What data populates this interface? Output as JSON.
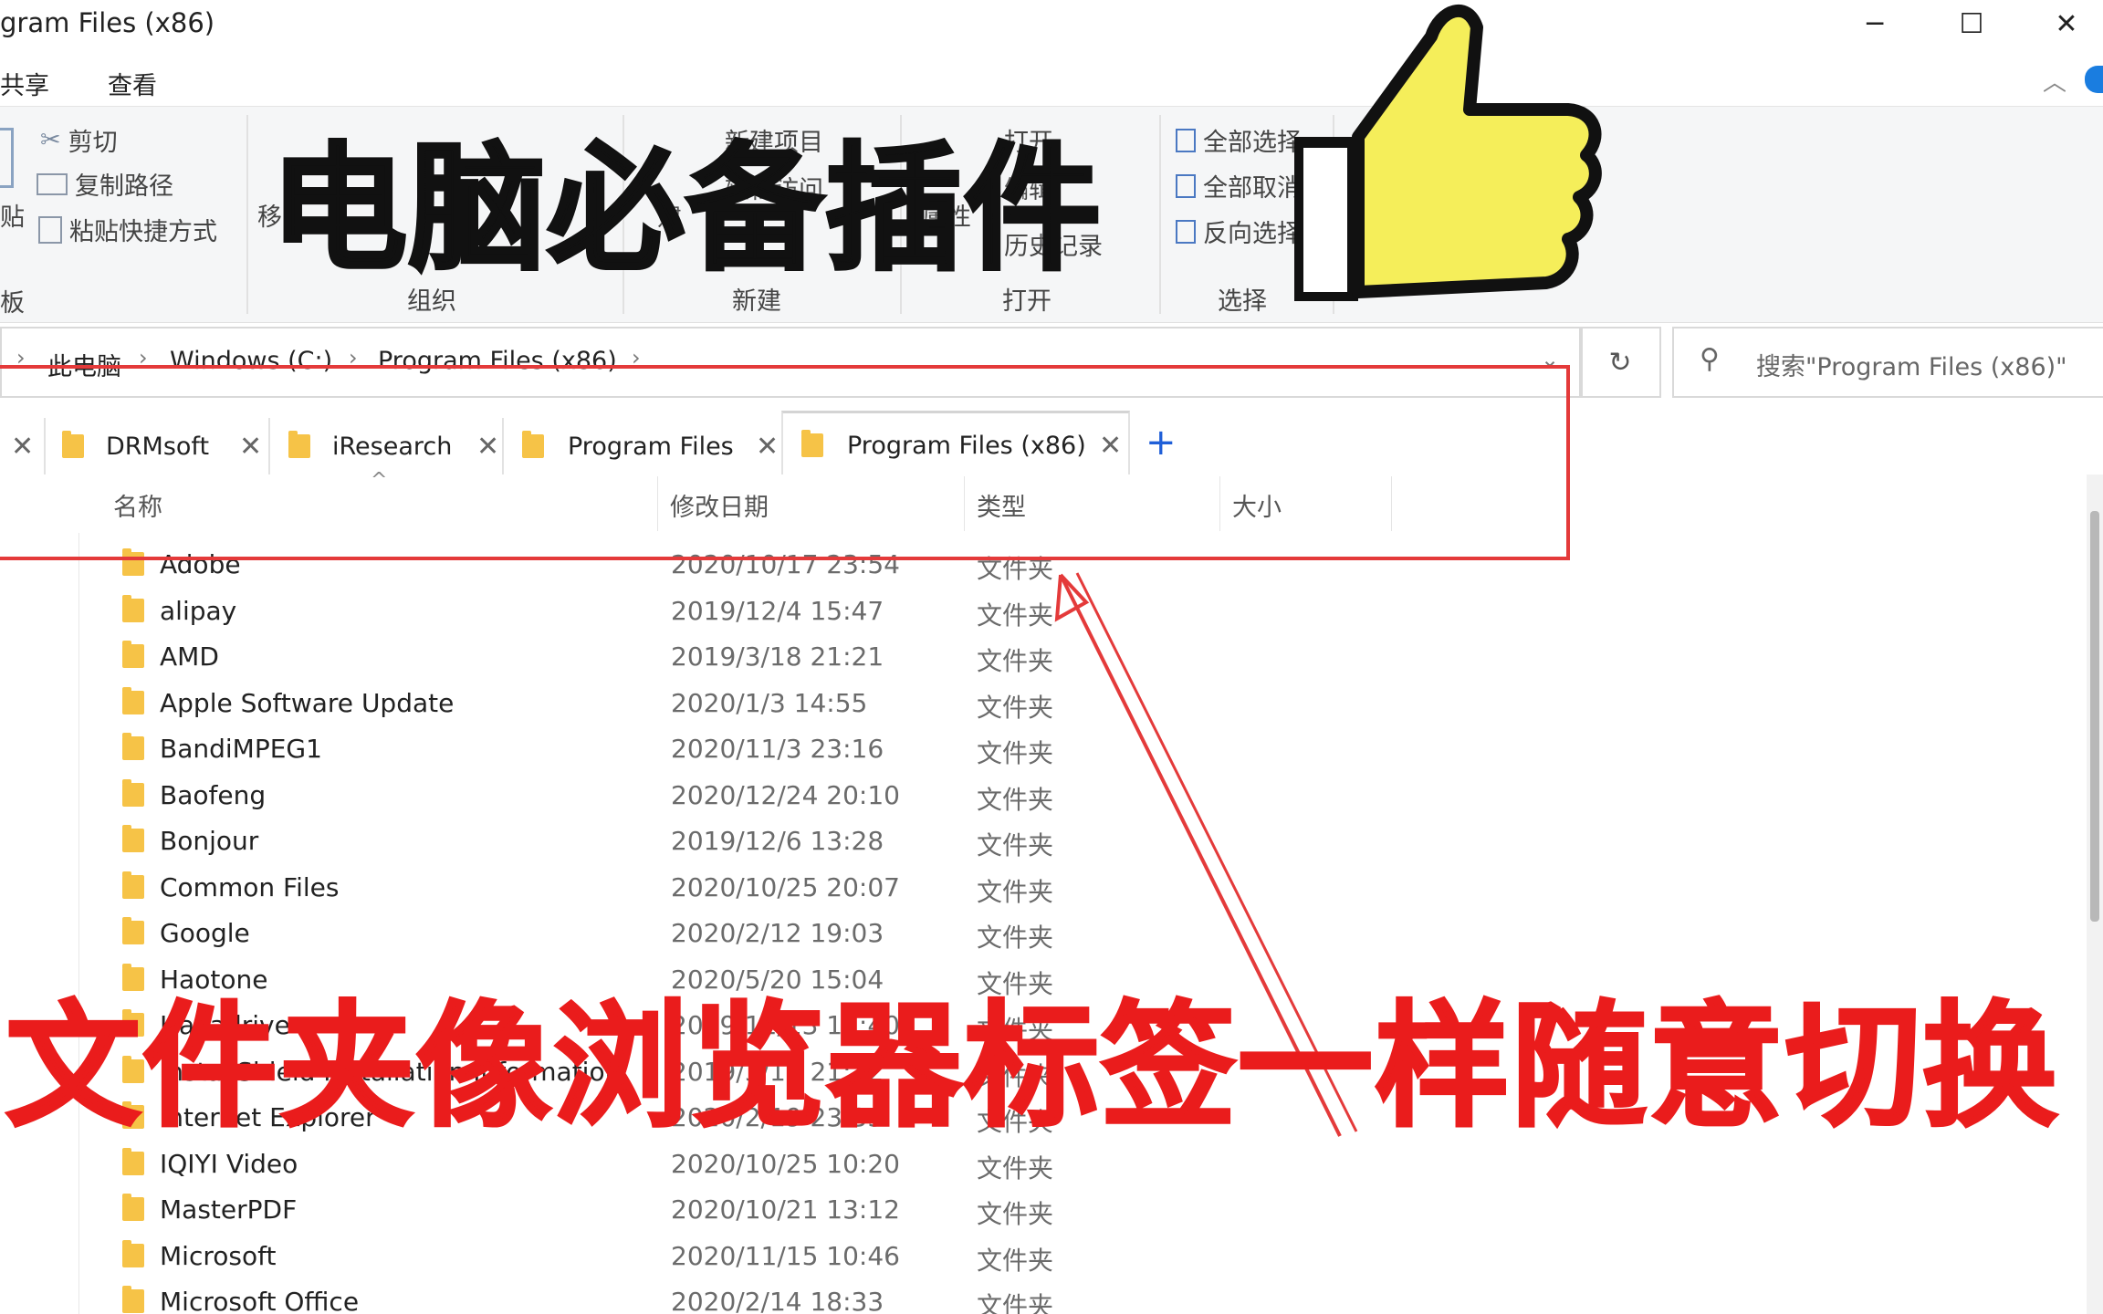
{
  "window": {
    "title": "gram Files (x86)",
    "minimize_glyph": "─",
    "maximize_glyph": "☐",
    "close_glyph": "✕"
  },
  "menu": {
    "share": "共享",
    "view": "查看"
  },
  "ribbon": {
    "cut": "剪切",
    "copy_path": "复制路径",
    "paste_shortcut": "粘贴快捷方式",
    "paste_fragment": "贴",
    "clipboard_fragment": "板",
    "move_fragment": "移",
    "new_item": "新建项目",
    "easy_access": "轻松访问",
    "new_folder_fragment": "建",
    "open": "打开",
    "edit": "编辑",
    "history": "历史记录",
    "properties": "属性",
    "select_all": "全部选择",
    "select_none": "全部取消",
    "invert_selection": "反向选择",
    "groups": {
      "organize": "组织",
      "new": "新建",
      "open": "打开",
      "select": "选择"
    }
  },
  "address": {
    "crumbs": [
      "此电脑",
      "Windows (C:)",
      "Program Files (x86)"
    ],
    "search_placeholder": "搜索\"Program Files (x86)\""
  },
  "tabs": [
    {
      "label": "DRMsoft"
    },
    {
      "label": "iResearch"
    },
    {
      "label": "Program Files"
    },
    {
      "label": "Program Files (x86)",
      "active": true
    }
  ],
  "add_tab_glyph": "+",
  "columns": {
    "name": "名称",
    "date": "修改日期",
    "type": "类型",
    "size": "大小"
  },
  "files": [
    {
      "name": "Adobe",
      "date": "2020/10/17 23:54",
      "type": "文件夹"
    },
    {
      "name": "alipay",
      "date": "2019/12/4 15:47",
      "type": "文件夹"
    },
    {
      "name": "AMD",
      "date": "2019/3/18 21:21",
      "type": "文件夹"
    },
    {
      "name": "Apple Software Update",
      "date": "2020/1/3 14:55",
      "type": "文件夹"
    },
    {
      "name": "BandiMPEG1",
      "date": "2020/11/3 23:16",
      "type": "文件夹"
    },
    {
      "name": "Baofeng",
      "date": "2020/12/24 20:10",
      "type": "文件夹"
    },
    {
      "name": "Bonjour",
      "date": "2019/12/6 13:28",
      "type": "文件夹"
    },
    {
      "name": "Common Files",
      "date": "2020/10/25 20:07",
      "type": "文件夹"
    },
    {
      "name": "Google",
      "date": "2020/2/12 19:03",
      "type": "文件夹"
    },
    {
      "name": "Haotone",
      "date": "2020/5/20 15:04",
      "type": "文件夹"
    },
    {
      "name": "Hayadrive",
      "date": "2019/11/13 15:40",
      "type": "文件夹"
    },
    {
      "name": "InstallShield Installation Information",
      "date": "2019/3/18 21:22",
      "type": "文件夹"
    },
    {
      "name": "Internet Explorer",
      "date": "2020/2/19 23:33",
      "type": "文件夹"
    },
    {
      "name": "IQIYI Video",
      "date": "2020/10/25 10:20",
      "type": "文件夹"
    },
    {
      "name": "MasterPDF",
      "date": "2020/10/21 13:12",
      "type": "文件夹"
    },
    {
      "name": "Microsoft",
      "date": "2020/11/15 10:46",
      "type": "文件夹"
    },
    {
      "name": "Microsoft Office",
      "date": "2020/2/14 18:33",
      "type": "文件夹"
    }
  ],
  "overlay": {
    "headline": "电脑必备插件",
    "caption": "文件夹像浏览器标签一样随意切换"
  },
  "colors": {
    "caption": "#ea1c1c",
    "annotation": "#e43a3a",
    "thumb": "#f5ee5a",
    "folder": "#f6c347",
    "add_tab": "#1f5fd8"
  }
}
